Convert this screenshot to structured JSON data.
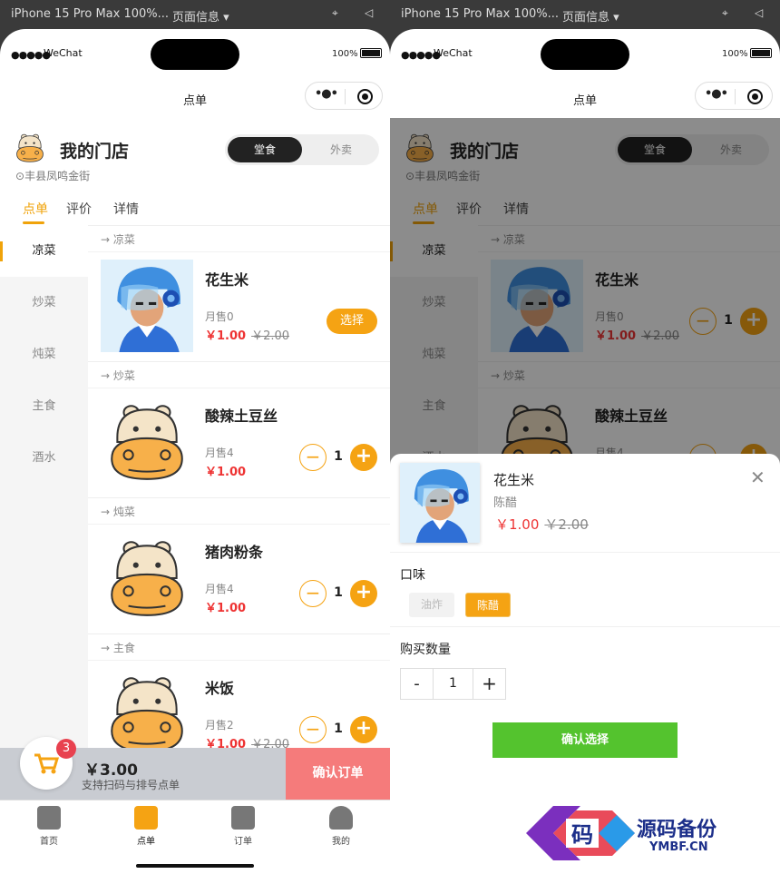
{
  "devtools": {
    "device": "iPhone 15 Pro Max 100%...",
    "page_info": "页面信息 ▾",
    "pin": "⌖",
    "sound": "◁"
  },
  "status": {
    "signal": "●●●●●",
    "carrier": "WeChat",
    "battery": "100%"
  },
  "nav": {
    "title": "点单",
    "more": "•●•"
  },
  "store": {
    "name": "我的门店",
    "address": "丰县凤鸣金街",
    "modes": [
      "堂食",
      "外卖"
    ],
    "tabs": [
      "点单",
      "评价",
      "详情"
    ]
  },
  "sidebar": [
    "凉菜",
    "炒菜",
    "炖菜",
    "主食",
    "酒水"
  ],
  "categories": [
    {
      "name": "凉菜",
      "items": [
        {
          "name": "花生米",
          "sold": "月售0",
          "price": "￥1.00",
          "old": "￥2.00",
          "action": "选择",
          "pic": "helmet"
        }
      ]
    },
    {
      "name": "炒菜",
      "items": [
        {
          "name": "酸辣土豆丝",
          "sold": "月售4",
          "price": "￥1.00",
          "old": "",
          "qty": "1",
          "pic": "hippo"
        }
      ]
    },
    {
      "name": "炖菜",
      "items": [
        {
          "name": "猪肉粉条",
          "sold": "月售4",
          "price": "￥1.00",
          "old": "",
          "qty": "1",
          "pic": "hippo"
        }
      ]
    },
    {
      "name": "主食",
      "items": [
        {
          "name": "米饭",
          "sold": "月售2",
          "price": "￥1.00",
          "old": "￥2.00",
          "qty": "1",
          "pic": "hippo"
        }
      ]
    }
  ],
  "right_first_item": {
    "qty": "1"
  },
  "cart": {
    "badge": "3",
    "total": "￥3.00",
    "hint": "支持扫码与排号点单",
    "confirm": "确认订单"
  },
  "tabbar": [
    {
      "label": "首页",
      "icon": "home-icon"
    },
    {
      "label": "点单",
      "icon": "bag-icon"
    },
    {
      "label": "订单",
      "icon": "clipboard-icon"
    },
    {
      "label": "我的",
      "icon": "user-icon"
    }
  ],
  "sheet": {
    "name": "花生米",
    "spec": "陈醋",
    "price": "￥1.00",
    "old": "￥2.00",
    "flavor_label": "口味",
    "options": [
      "油炸",
      "陈醋"
    ],
    "qty_label": "购买数量",
    "qty": "1",
    "minus": "-",
    "plus": "+",
    "confirm": "确认选择",
    "close": "✕"
  },
  "watermark": {
    "char": "码",
    "title": "源码备份",
    "site": "YMBF.CN"
  },
  "colors": {
    "accent": "#f5a313",
    "price": "#e33333",
    "confirm_order": "#f57b7b",
    "confirm_select": "#54c32e"
  }
}
